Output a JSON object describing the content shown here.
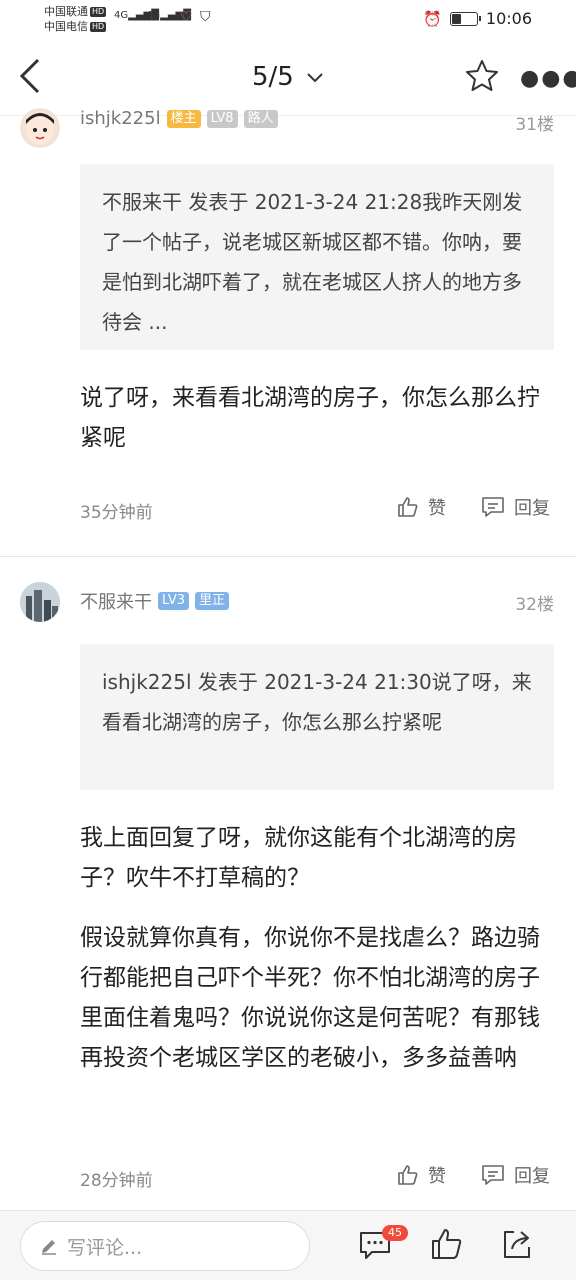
{
  "status_bar": {
    "carrier1": "中国联通",
    "carrier2": "中国电信",
    "hd": "HD",
    "net1": "4G",
    "net2": "4G",
    "time": "10:06",
    "battery_level": 0.35
  },
  "header": {
    "page_indicator": "5/5"
  },
  "post31": {
    "username": "ishjk225l",
    "tags": [
      "楼主",
      "LV8",
      "路人"
    ],
    "floor": "31楼",
    "quote": "不服来干 发表于 2021-3-24 21:28我昨天刚发了一个帖子，说老城区新城区都不错。你呐，要是怕到北湖吓着了，就在老城区人挤人的地方多待会 ...",
    "body": "说了呀，来看看北湖湾的房子，你怎么那么拧紧呢",
    "time": "35分钟前",
    "like_label": "赞",
    "reply_label": "回复"
  },
  "post32": {
    "username": "不服来干",
    "tags": [
      "LV3",
      "里正"
    ],
    "floor": "32楼",
    "quote": "ishjk225l 发表于 2021-3-24 21:30说了呀，来看看北湖湾的房子，你怎么那么拧紧呢",
    "body1": "我上面回复了呀，就你这能有个北湖湾的房子？吹牛不打草稿的？",
    "body2": "假设就算你真有，你说你不是找虐么？路边骑行都能把自己吓个半死？你不怕北湖湾的房子里面住着鬼吗？你说说你这是何苦呢？有那钱再投资个老城区学区的老破小，多多益善呐",
    "time": "28分钟前",
    "like_label": "赞",
    "reply_label": "回复"
  },
  "bottom_bar": {
    "comment_placeholder": "写评论...",
    "comment_count": "45"
  },
  "colors": {
    "tag_owner": "#f5b942",
    "tag_level": "#c8c8c8",
    "tag_level_blue": "#7fb2e8",
    "tag_role_gray": "#c8c8c8",
    "tag_role_blue": "#7fb2e8",
    "badge": "#f04a3a"
  }
}
